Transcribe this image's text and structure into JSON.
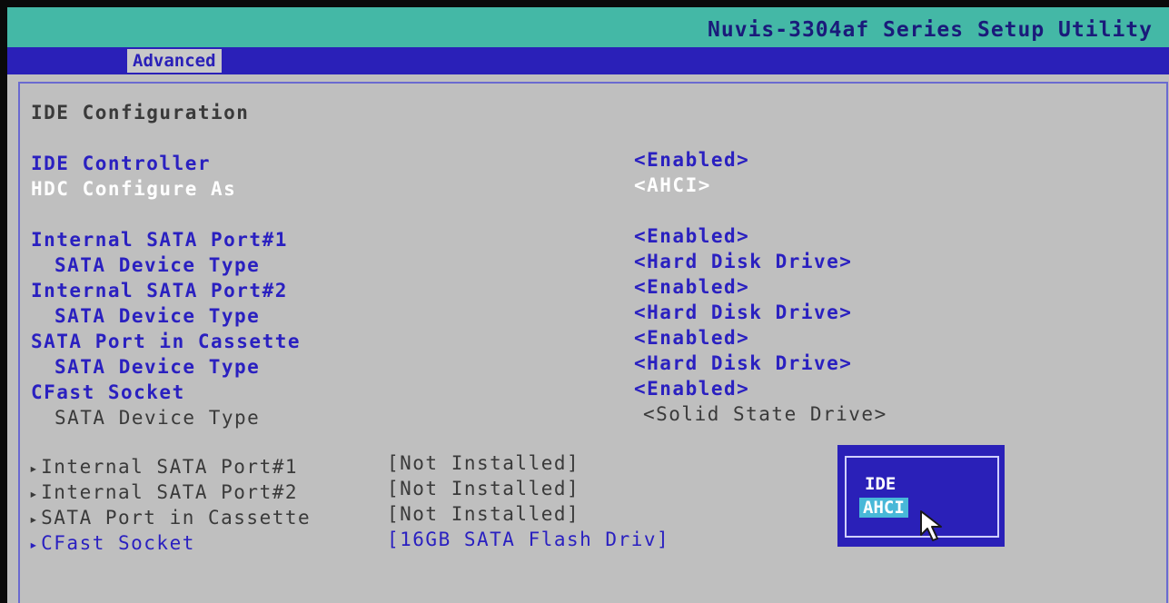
{
  "header": {
    "title": "Nuvis-3304af Series Setup Utility"
  },
  "menu": {
    "tabs": [
      {
        "label": "Advanced",
        "active": true
      }
    ]
  },
  "page": {
    "heading": "IDE Configuration"
  },
  "settings": [
    {
      "label": "IDE Controller",
      "value": "<Enabled>"
    },
    {
      "label": "HDC Configure As",
      "value": "<AHCI>",
      "selected": true
    },
    {
      "label": "Internal SATA Port#1",
      "value": "<Enabled>"
    },
    {
      "label": "SATA Device Type",
      "value": "<Hard Disk Drive>"
    },
    {
      "label": "Internal SATA Port#2",
      "value": "<Enabled>"
    },
    {
      "label": "SATA Device Type",
      "value": "<Hard Disk Drive>"
    },
    {
      "label": "SATA Port in Cassette",
      "value": "<Enabled>"
    },
    {
      "label": "SATA Device Type",
      "value": "<Hard Disk Drive>"
    },
    {
      "label": "CFast Socket",
      "value": "<Enabled>"
    },
    {
      "label": "SATA Device Type",
      "value": "<Solid State Drive>",
      "readonly": true
    }
  ],
  "submenus": [
    {
      "label": "Internal SATA Port#1",
      "status": "[Not Installed]"
    },
    {
      "label": "Internal SATA Port#2",
      "status": "[Not Installed]"
    },
    {
      "label": "SATA Port in Cassette",
      "status": "[Not Installed]"
    },
    {
      "label": "CFast Socket",
      "status": "[16GB SATA Flash Driv]"
    }
  ],
  "popup": {
    "options": [
      "IDE",
      "AHCI"
    ],
    "selected": "AHCI"
  },
  "colors": {
    "background": "#bfbfbf",
    "title_bar": "#44b8a6",
    "menu_bar": "#2a20b8",
    "text_blue": "#2a20c0",
    "highlight": "#48b8d8"
  }
}
